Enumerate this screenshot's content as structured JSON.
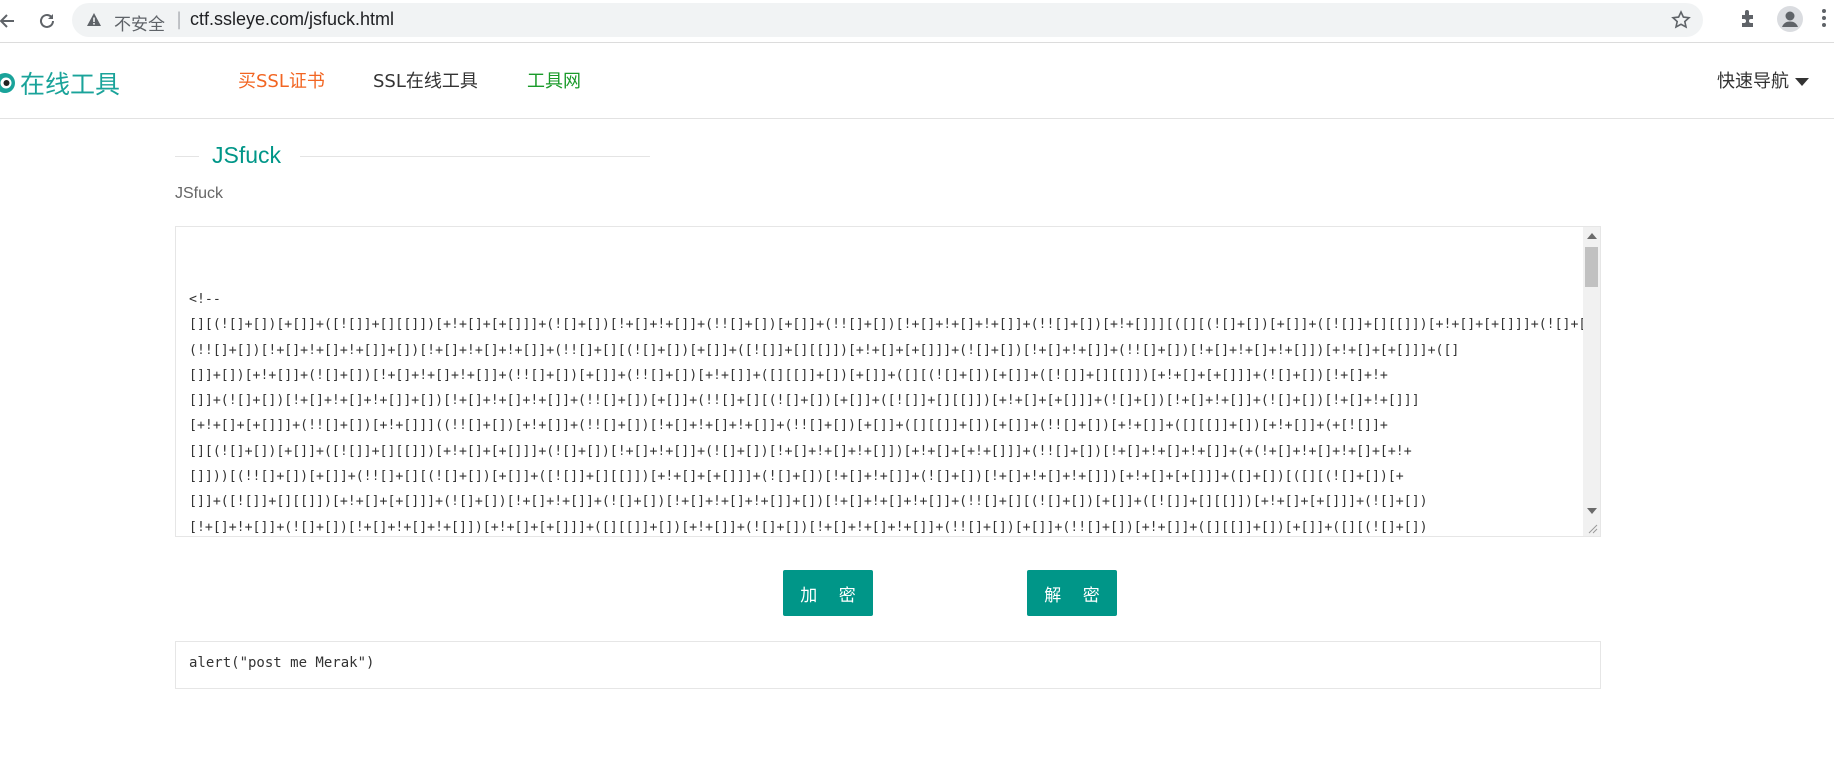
{
  "browser": {
    "security_label": "不安全",
    "url": "ctf.ssleye.com/jsfuck.html",
    "icons": [
      "back-arrow-icon",
      "reload-icon",
      "warning-icon",
      "star-icon",
      "extensions-icon",
      "profile-icon",
      "more-menu-icon"
    ]
  },
  "header": {
    "logo_text": "在线工具",
    "nav": {
      "buy_ssl": "买SSL证书",
      "ssl_tools": "SSL在线工具",
      "tools_site": "工具网"
    },
    "quick_nav": "快速导航",
    "colors": {
      "brand": "#1aa39a",
      "buy": "#f26522",
      "tools": "#1a9a2a"
    }
  },
  "main": {
    "title": "JSfuck",
    "subtitle": "JSfuck",
    "input_text": "<!--\n[][(![]+[])[+[]]+([![]]+[][[]])[+!+[]+[+[]]]+(![]+[])[!+[]+!+[]]+(!![]+[])[+[]]+(!![]+[])[!+[]+!+[]+!+[]]+(!![]+[])[+!+[]]][([][(![]+[])[+[]]+([![]]+[][[]])[+!+[]+[+[]]]+(![]+[])[!+[]+!+[]]+\n(!![]+[])[!+[]+!+[]+!+[]]+[])[!+[]+!+[]+!+[]]+(!![]+[][(![]+[])[+[]]+([![]]+[][[]])[+!+[]+[+[]]]+(![]+[])[!+[]+!+[]]+(!![]+[])[!+[]+!+[]+!+[]])[+!+[]+[+[]]]+([]\n[]]+[])[+!+[]]+(![]+[])[!+[]+!+[]+!+[]]+(!![]+[])[+[]]+(!![]+[])[+!+[]]+([][[]]+[])[+[]]+([][(![]+[])[+[]]+([![]]+[][[]])[+!+[]+[+[]]]+(![]+[])[!+[]+!+\n[]]+(![]+[])[!+[]+!+[]+!+[]]+[])[!+[]+!+[]+!+[]]+(!![]+[])[+[]]+(!![]+[][(![]+[])[+[]]+([![]]+[][[]])[+!+[]+[+[]]]+(![]+[])[!+[]+!+[]]+(![]+[])[!+[]+!+[]]]\n[+!+[]+[+[]]]+(!![]+[])[+!+[]]]((!![]+[])[+!+[]]+(!![]+[])[!+[]+!+[]+!+[]]+(!![]+[])[+[]]+([][[]]+[])[+[]]+(!![]+[])[+!+[]]+([][[]]+[])[+!+[]]+(+[![]]+\n[][(![]+[])[+[]]+([![]]+[][[]])[+!+[]+[+[]]]+(![]+[])[!+[]+!+[]]+(![]+[])[!+[]+!+[]+!+[]])[+!+[]+[+!+[]]]+(!![]+[])[!+[]+!+[]+!+[]]+(+(!+[]+!+[]+!+[]+[+!+\n[]]))[(!![]+[])[+[]]+(!![]+[][(![]+[])[+[]]+([![]]+[][[]])[+!+[]+[+[]]]+(![]+[])[!+[]+!+[]]+(![]+[])[!+[]+!+[]+!+[]])[+!+[]+[+[]]]+([]+[])[([][(![]+[])[+\n[]]+([![]]+[][[]])[+!+[]+[+[]]]+(![]+[])[!+[]+!+[]]+(![]+[])[!+[]+!+[]+!+[]]+[])[!+[]+!+[]+!+[]]+(!![]+[][(![]+[])[+[]]+([![]]+[][[]])[+!+[]+[+[]]]+(![]+[])\n[!+[]+!+[]]+(![]+[])[!+[]+!+[]+!+[]])[+!+[]+[+[]]]+([][[]]+[])[+!+[]]+(![]+[])[!+[]+!+[]+!+[]]+(!![]+[])[+[]]+(!![]+[])[+!+[]]+([][[]]+[])[+[]]+([][(![]+[])",
    "encrypt_label": "加 密",
    "decrypt_label": "解 密",
    "output_text": "alert(\"post me Merak\")",
    "accent_color": "#009688"
  }
}
